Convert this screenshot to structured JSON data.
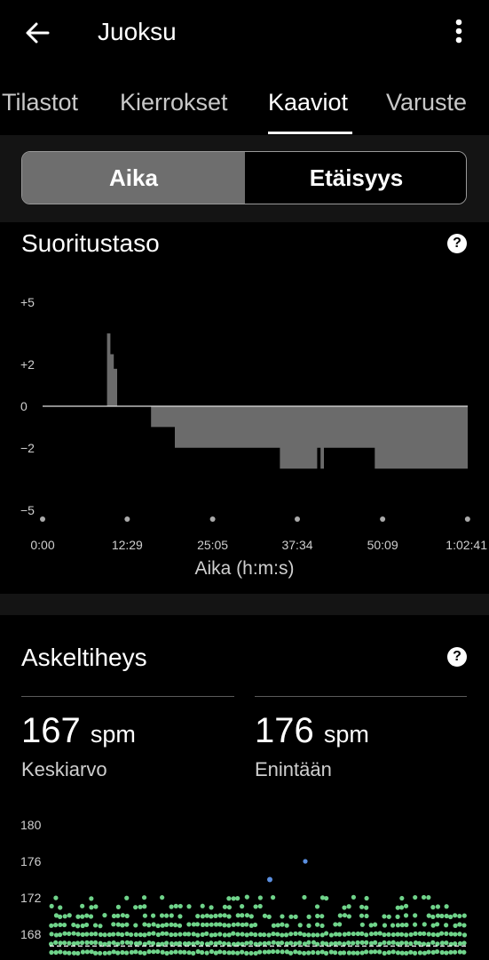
{
  "header": {
    "title": "Juoksu",
    "back_icon": "arrow-left-icon",
    "menu_icon": "more-vertical-icon"
  },
  "tabs": [
    {
      "label": "Tilastot",
      "active": false
    },
    {
      "label": "Kierrokset",
      "active": false
    },
    {
      "label": "Kaaviot",
      "active": true
    },
    {
      "label": "Varuste",
      "active": false
    }
  ],
  "segment": {
    "left": "Aika",
    "right": "Etäisyys",
    "selected": "Aika"
  },
  "performance": {
    "title": "Suoritustaso",
    "help_icon": "help-circle-icon",
    "chart_data": {
      "type": "area",
      "yticks": [
        "+5",
        "+2",
        "0",
        "−2",
        "−5"
      ],
      "ylim": [
        -5,
        5
      ],
      "xticks": [
        "0:00",
        "12:29",
        "25:05",
        "37:34",
        "50:09",
        "1:02:41"
      ],
      "xlabel": "Aika (h:m:s)",
      "x_minutes": [
        0,
        9.5,
        9.5,
        10.0,
        10.0,
        10.5,
        10.5,
        11.0,
        11.0,
        16.0,
        16.0,
        19.5,
        19.5,
        35.0,
        35.0,
        40.5,
        40.5,
        41.0,
        41.0,
        41.5,
        41.5,
        49.0,
        49.0,
        62.7
      ],
      "y_values": [
        0,
        0,
        3.5,
        3.5,
        2.5,
        2.5,
        1.8,
        1.8,
        0,
        0,
        -1,
        -1,
        -2,
        -2,
        -3,
        -3,
        -2,
        -2,
        -3,
        -3,
        -2,
        -2,
        -3,
        -3
      ],
      "fill_color": "#6b6b6b"
    }
  },
  "cadence": {
    "title": "Askeltiheys",
    "help_icon": "help-circle-icon",
    "average": {
      "value": "167",
      "unit": "spm",
      "label": "Keskiarvo"
    },
    "max": {
      "value": "176",
      "unit": "spm",
      "label": "Enintään"
    },
    "chart_data": {
      "type": "scatter",
      "yticks": [
        "180",
        "176",
        "172",
        "168"
      ],
      "ylim": [
        166,
        181
      ],
      "point_color": "#6fd38a",
      "highlight_color": "#5b8fe0",
      "max_value": 176
    }
  }
}
